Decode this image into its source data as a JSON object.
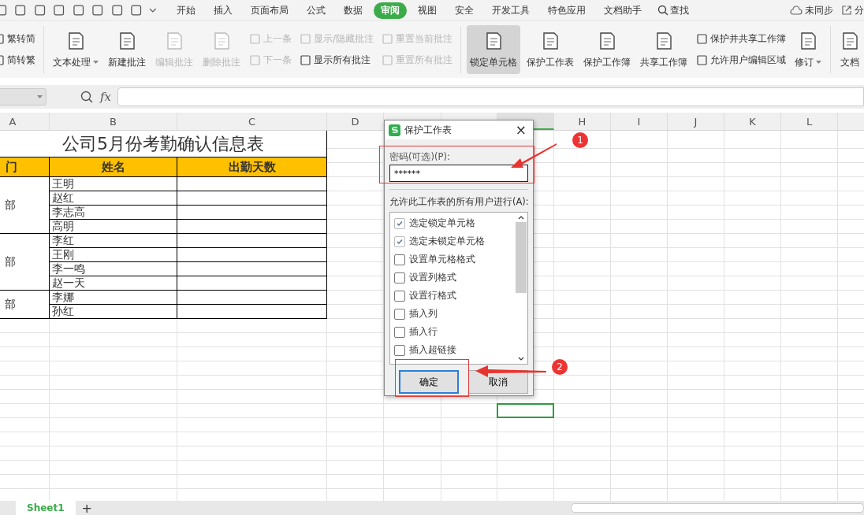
{
  "menu_tabs": [
    {
      "label": "开始",
      "selected": false
    },
    {
      "label": "插入",
      "selected": false
    },
    {
      "label": "页面布局",
      "selected": false
    },
    {
      "label": "公式",
      "selected": false
    },
    {
      "label": "数据",
      "selected": false
    },
    {
      "label": "审阅",
      "selected": true
    },
    {
      "label": "视图",
      "selected": false
    },
    {
      "label": "安全",
      "selected": false
    },
    {
      "label": "开发工具",
      "selected": false
    },
    {
      "label": "特色应用",
      "selected": false
    },
    {
      "label": "文档助手",
      "selected": false
    }
  ],
  "search": "查找",
  "sync": "未同步",
  "share": "分",
  "ribbon": [
    {
      "kind": "stack",
      "items": [
        {
          "label": "繁转简",
          "disabled": false
        },
        {
          "label": "简转繁",
          "disabled": false
        }
      ]
    },
    {
      "kind": "large",
      "label": "文本处理",
      "disabled": false,
      "selected": false,
      "dropdown": true,
      "divider": true
    },
    {
      "kind": "large",
      "label": "新建批注",
      "disabled": false,
      "selected": false,
      "dropdown": false
    },
    {
      "kind": "large",
      "label": "编辑批注",
      "disabled": true,
      "selected": false,
      "dropdown": false
    },
    {
      "kind": "large",
      "label": "删除批注",
      "disabled": true,
      "selected": false,
      "dropdown": false
    },
    {
      "kind": "stack",
      "items": [
        {
          "label": "上一条",
          "disabled": true
        },
        {
          "label": "下一条",
          "disabled": true
        }
      ]
    },
    {
      "kind": "stack",
      "items": [
        {
          "label": "显示/隐藏批注",
          "disabled": true
        },
        {
          "label": "显示所有批注",
          "disabled": false
        }
      ]
    },
    {
      "kind": "stack",
      "items": [
        {
          "label": "重置当前批注",
          "disabled": true
        },
        {
          "label": "重置所有批注",
          "disabled": true
        }
      ]
    },
    {
      "kind": "large",
      "label": "锁定单元格",
      "disabled": false,
      "selected": true,
      "dropdown": false,
      "divider": true
    },
    {
      "kind": "large",
      "label": "保护工作表",
      "disabled": false,
      "selected": false,
      "dropdown": false
    },
    {
      "kind": "large",
      "label": "保护工作簿",
      "disabled": false,
      "selected": false,
      "dropdown": false
    },
    {
      "kind": "large",
      "label": "共享工作簿",
      "disabled": false,
      "selected": false,
      "dropdown": false
    },
    {
      "kind": "stack",
      "items": [
        {
          "label": "保护并共享工作簿",
          "disabled": false
        },
        {
          "label": "允许用户编辑区域",
          "disabled": false
        }
      ]
    },
    {
      "kind": "large",
      "label": "修订",
      "disabled": false,
      "selected": false,
      "dropdown": true
    },
    {
      "kind": "large",
      "label": "文档",
      "disabled": false,
      "selected": false,
      "dropdown": false,
      "divider": true
    }
  ],
  "formula_bar": {
    "fx": "fx"
  },
  "columns": [
    {
      "label": "A",
      "selected": false
    },
    {
      "label": "B",
      "selected": false
    },
    {
      "label": "C",
      "selected": false
    },
    {
      "label": "D",
      "selected": false
    },
    {},
    {},
    {
      "selected": true
    },
    {
      "label": "H",
      "selected": false
    },
    {
      "label": "I",
      "selected": false
    },
    {
      "label": "J",
      "selected": false
    },
    {
      "label": "K",
      "selected": false
    },
    {
      "label": "L",
      "selected": false
    },
    {}
  ],
  "sheet": {
    "title": "公司5月份考勤确认信息表",
    "headers": [
      "门",
      "姓名",
      "出勤天数"
    ],
    "groups": [
      {
        "department": "部",
        "names": [
          "王明",
          "赵红",
          "李志高",
          "高明"
        ]
      },
      {
        "department": "部",
        "names": [
          "李红",
          "王刚",
          "李一鸣",
          "赵一天"
        ]
      },
      {
        "department": "部",
        "names": [
          "李娜",
          "孙红"
        ]
      }
    ]
  },
  "sheet_tabs": [
    {
      "label": "Sheet1",
      "selected": true
    }
  ],
  "add_sheet": "+",
  "dialog": {
    "title": "保护工作表",
    "password_label": "密码(可选)(P):",
    "password": "******",
    "allow_label": "允许此工作表的所有用户进行(A):",
    "options": [
      {
        "label": "选定锁定单元格",
        "checked": true
      },
      {
        "label": "选定未锁定单元格",
        "checked": true
      },
      {
        "label": "设置单元格格式",
        "checked": false
      },
      {
        "label": "设置列格式",
        "checked": false
      },
      {
        "label": "设置行格式",
        "checked": false
      },
      {
        "label": "插入列",
        "checked": false
      },
      {
        "label": "插入行",
        "checked": false
      },
      {
        "label": "插入超链接",
        "checked": false
      }
    ],
    "ok": "确定",
    "cancel": "取消",
    "close": "×"
  },
  "callouts": [
    "1",
    "2"
  ]
}
